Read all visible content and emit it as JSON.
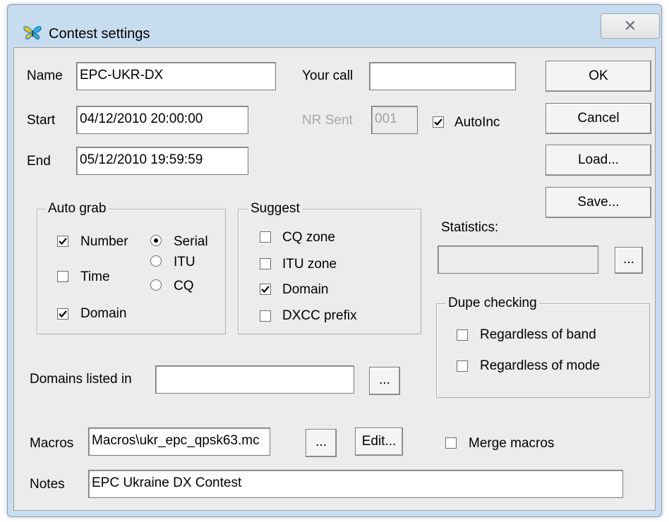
{
  "window": {
    "title": "Contest settings",
    "close_glyph": "✕"
  },
  "fields": {
    "name_label": "Name",
    "name_value": "EPC-UKR-DX",
    "yourcall_label": "Your call",
    "yourcall_value": "",
    "start_label": "Start",
    "start_value": "04/12/2010 20:00:00",
    "nrsent_label": "NR Sent",
    "nrsent_value": "001",
    "autoinc_label": "AutoInc",
    "autoinc_checked": true,
    "end_label": "End",
    "end_value": "05/12/2010 19:59:59"
  },
  "buttons": {
    "ok": "OK",
    "cancel": "Cancel",
    "load": "Load...",
    "save": "Save...",
    "ellipsis": "...",
    "edit": "Edit..."
  },
  "autograb": {
    "title": "Auto grab",
    "number": {
      "label": "Number",
      "checked": true
    },
    "time": {
      "label": "Time",
      "checked": false
    },
    "domain": {
      "label": "Domain",
      "checked": true
    },
    "serial": {
      "label": "Serial",
      "selected": true
    },
    "itu": {
      "label": "ITU",
      "selected": false
    },
    "cq": {
      "label": "CQ",
      "selected": false
    }
  },
  "suggest": {
    "title": "Suggest",
    "cqzone": {
      "label": "CQ zone",
      "checked": false
    },
    "ituzone": {
      "label": "ITU zone",
      "checked": false
    },
    "domain": {
      "label": "Domain",
      "checked": true
    },
    "dxcc": {
      "label": "DXCC prefix",
      "checked": false
    }
  },
  "statistics": {
    "label": "Statistics:",
    "value": ""
  },
  "dupe": {
    "title": "Dupe checking",
    "band": {
      "label": "Regardless of band",
      "checked": false
    },
    "mode": {
      "label": "Regardless of mode",
      "checked": false
    }
  },
  "domains": {
    "label": "Domains listed in",
    "value": ""
  },
  "macros": {
    "label": "Macros",
    "value": "Macros\\ukr_epc_qpsk63.mc",
    "merge_label": "Merge macros",
    "merge_checked": false
  },
  "notes": {
    "label": "Notes",
    "value": "EPC Ukraine DX Contest"
  }
}
